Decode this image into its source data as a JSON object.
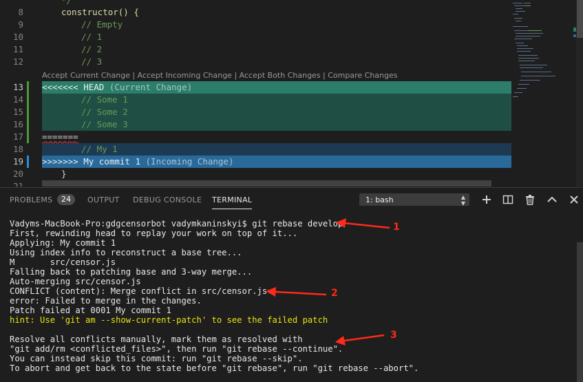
{
  "editor": {
    "lines": [
      {
        "num": "8",
        "text": "constructor() {"
      },
      {
        "num": "9",
        "text": "// Empty"
      },
      {
        "num": "10",
        "text": "// 1"
      },
      {
        "num": "11",
        "text": "// 2"
      },
      {
        "num": "12",
        "text": "// 3"
      },
      {
        "num": "13",
        "marker": "<<<<<<< HEAD",
        "note": "(Current Change)"
      },
      {
        "num": "14",
        "text": "// Some 1"
      },
      {
        "num": "15",
        "text": "// Some 2"
      },
      {
        "num": "16",
        "text": "// Some 3"
      },
      {
        "num": "17",
        "text": "======="
      },
      {
        "num": "18",
        "text": "// My 1"
      },
      {
        "num": "19",
        "marker": ">>>>>>> My commit 1",
        "note": "(Incoming Change)"
      },
      {
        "num": "20",
        "text": "}"
      },
      {
        "num": "21",
        "text": ""
      }
    ],
    "codelens": {
      "accept_current": "Accept Current Change",
      "accept_incoming": "Accept Incoming Change",
      "accept_both": "Accept Both Changes",
      "compare": "Compare Changes",
      "separator": " | "
    }
  },
  "panel": {
    "tabs": {
      "problems": "PROBLEMS",
      "problems_count": "24",
      "output": "OUTPUT",
      "debug_console": "DEBUG CONSOLE",
      "terminal": "TERMINAL"
    },
    "terminal_select": "1: bash",
    "actions": [
      "plus-icon",
      "split-icon",
      "trash-icon",
      "chevron-up-icon",
      "close-icon"
    ]
  },
  "terminal": {
    "lines": [
      "Vadyms-MacBook-Pro:gdgcensorbot vadymkaninskyi$ git rebase develop",
      "First, rewinding head to replay your work on top of it...",
      "Applying: My commit 1",
      "Using index info to reconstruct a base tree...",
      "M       src/censor.js",
      "Falling back to patching base and 3-way merge...",
      "Auto-merging src/censor.js",
      "CONFLICT (content): Merge conflict in src/censor.js",
      "error: Failed to merge in the changes.",
      "Patch failed at 0001 My commit 1",
      "hint: Use 'git am --show-current-patch' to see the failed patch",
      "",
      "Resolve all conflicts manually, mark them as resolved with",
      "\"git add/rm <conflicted_files>\", then run \"git rebase --continue\".",
      "You can instead skip this commit: run \"git rebase --skip\".",
      "To abort and get back to the state before \"git rebase\", run \"git rebase --abort\"."
    ]
  },
  "annotations": {
    "labels": [
      "1",
      "2",
      "3"
    ],
    "color": "#ff2a1a"
  },
  "colors": {
    "current_change": "#2d7d6b",
    "incoming_change": "#2a6a9a",
    "comment": "#6a9955",
    "hint": "#e5e510"
  }
}
